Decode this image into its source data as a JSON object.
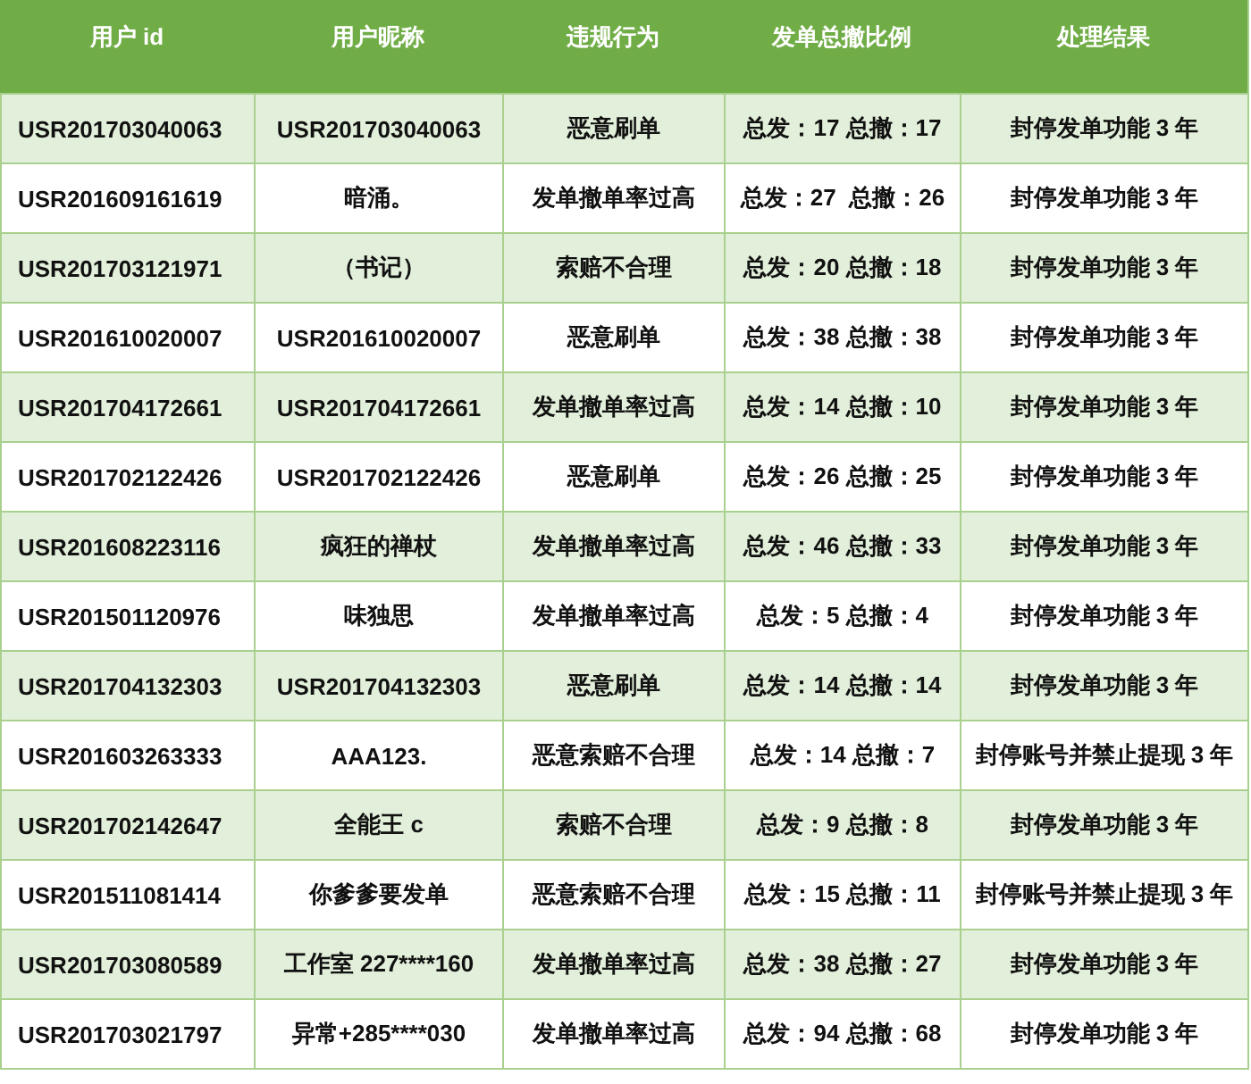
{
  "table": {
    "columns": [
      "用户 id",
      "用户昵称",
      "违规行为",
      "发单总撤比例",
      "处理结果"
    ],
    "rows": [
      [
        "USR201703040063",
        "USR201703040063",
        "恶意刷单",
        "总发：17 总撤：17",
        "封停发单功能 3 年"
      ],
      [
        "USR201609161619",
        "暗涌。",
        "发单撤单率过高",
        "总发：27  总撤：26",
        "封停发单功能 3 年"
      ],
      [
        "USR201703121971",
        "（书记）",
        "索赔不合理",
        "总发：20 总撤：18",
        "封停发单功能 3 年"
      ],
      [
        "USR201610020007",
        "USR201610020007",
        "恶意刷单",
        "总发：38 总撤：38",
        "封停发单功能 3 年"
      ],
      [
        "USR201704172661",
        "USR201704172661",
        "发单撤单率过高",
        "总发：14 总撤：10",
        "封停发单功能 3 年"
      ],
      [
        "USR201702122426",
        "USR201702122426",
        "恶意刷单",
        "总发：26 总撤：25",
        "封停发单功能 3 年"
      ],
      [
        "USR201608223116",
        "疯狂的禅杖",
        "发单撤单率过高",
        "总发：46 总撤：33",
        "封停发单功能 3 年"
      ],
      [
        "USR201501120976",
        "味独思",
        "发单撤单率过高",
        "总发：5 总撤：4",
        "封停发单功能 3 年"
      ],
      [
        "USR201704132303",
        "USR201704132303",
        "恶意刷单",
        "总发：14 总撤：14",
        "封停发单功能 3 年"
      ],
      [
        "USR201603263333",
        "AAA123.",
        "恶意索赔不合理",
        "总发：14 总撤：7",
        "封停账号并禁止提现 3 年"
      ],
      [
        "USR201702142647",
        "全能王 c",
        "索赔不合理",
        "总发：9 总撤：8",
        "封停发单功能 3 年"
      ],
      [
        "USR201511081414",
        "你爹爹要发单",
        "恶意索赔不合理",
        "总发：15 总撤：11",
        "封停账号并禁止提现 3 年"
      ],
      [
        "USR201703080589",
        "工作室 227****160",
        "发单撤单率过高",
        "总发：38 总撤：27",
        "封停发单功能 3 年"
      ],
      [
        "USR201703021797",
        "异常+285****030",
        "发单撤单率过高",
        "总发：94 总撤：68",
        "封停发单功能 3 年"
      ]
    ]
  }
}
